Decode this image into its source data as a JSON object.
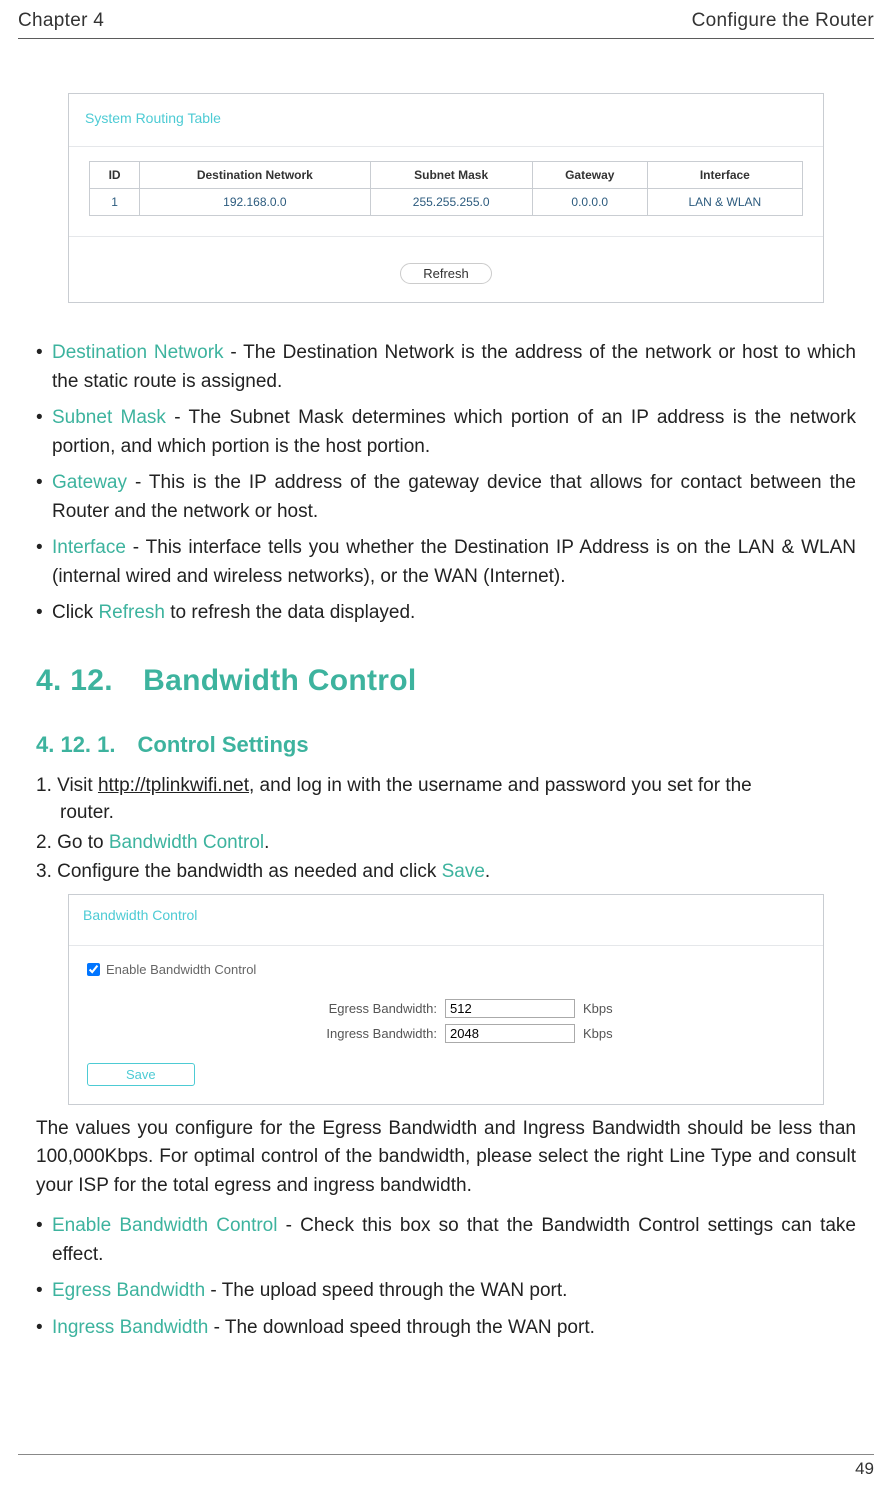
{
  "header": {
    "chapter": "Chapter 4",
    "title": "Configure the Router"
  },
  "routing_panel": {
    "title": "System Routing Table",
    "columns": [
      "ID",
      "Destination Network",
      "Subnet Mask",
      "Gateway",
      "Interface"
    ],
    "row": {
      "id": "1",
      "dest": "192.168.0.0",
      "mask": "255.255.255.0",
      "gw": "0.0.0.0",
      "iface": "LAN & WLAN"
    },
    "refresh_label": "Refresh"
  },
  "bullets_top": [
    {
      "term": "Destination Network",
      "text": " - The Destination Network is the address of the network or host to which the static route is assigned."
    },
    {
      "term": "Subnet Mask",
      "text": " - The Subnet Mask determines which portion of an IP address is the network portion, and which portion is the host portion."
    },
    {
      "term": "Gateway",
      "text": " - This is the IP address of the gateway device that allows for contact between the Router and the network or host."
    },
    {
      "term": "Interface",
      "text": " - This interface tells you whether the Destination IP Address is on the LAN & WLAN (internal wired and wireless networks), or the WAN (Internet)."
    }
  ],
  "refresh_line": {
    "pre": "Click ",
    "term": "Refresh",
    "post": " to refresh the data displayed."
  },
  "h2": "4. 12. Bandwidth Control",
  "h3": "4. 12. 1. Control Settings",
  "steps": {
    "s1_pre": "1. Visit ",
    "s1_link": "http://tplinkwifi.net",
    "s1_post": ", and log in with the username and password you set for the",
    "s1_cont": "router.",
    "s2_pre": "2. Go to ",
    "s2_term": "Bandwidth Control",
    "s2_post": ".",
    "s3_pre": "3. Configure the bandwidth as needed and click ",
    "s3_term": "Save",
    "s3_post": "."
  },
  "bw_panel": {
    "title": "Bandwidth Control",
    "enable_label": "Enable Bandwidth Control",
    "enable_checked": true,
    "egress_label": "Egress Bandwidth:",
    "egress_value": "512",
    "ingress_label": "Ingress Bandwidth:",
    "ingress_value": "2048",
    "unit": "Kbps",
    "save_label": "Save"
  },
  "para": "The values you configure for the Egress Bandwidth and Ingress Bandwidth should be less than 100,000Kbps. For optimal control of the bandwidth, please select the right Line Type and consult your ISP for the total egress and ingress bandwidth.",
  "bullets_bottom": [
    {
      "term": "Enable Bandwidth Control",
      "text": " - Check this box so that the Bandwidth Control settings can take effect."
    },
    {
      "term": "Egress Bandwidth",
      "text": " - The upload speed through the WAN port."
    },
    {
      "term": "Ingress Bandwidth",
      "text": " - The download speed through the WAN port."
    }
  ],
  "page_number": "49"
}
